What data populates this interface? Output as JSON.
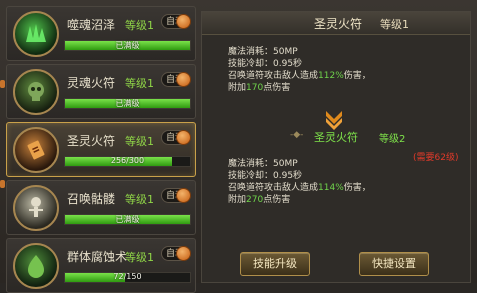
{
  "skills": [
    {
      "name": "噬魂沼泽",
      "level": "等级1",
      "auto": "自动",
      "bar_text": "已满级",
      "progress": 1.0,
      "icon": "swamp-icon"
    },
    {
      "name": "灵魂火符",
      "level": "等级1",
      "auto": "自动",
      "bar_text": "已满级",
      "progress": 1.0,
      "icon": "skull-icon"
    },
    {
      "name": "圣灵火符",
      "level": "等级1",
      "auto": "自动",
      "bar_text": "256/300",
      "progress": 0.853,
      "icon": "fire-talisman-icon"
    },
    {
      "name": "召唤骷髅",
      "level": "等级1",
      "auto": "自动",
      "bar_text": "已满级",
      "progress": 1.0,
      "icon": "skeleton-icon"
    },
    {
      "name": "群体腐蚀术",
      "level": "等级1",
      "auto": "自动",
      "bar_text": "72/150",
      "progress": 0.48,
      "icon": "corrosion-icon"
    }
  ],
  "detail": {
    "name": "圣灵火符",
    "level": "等级1",
    "current": {
      "mana": "魔法消耗：50MP",
      "cooldown": "技能冷却：0.95秒",
      "desc_pre": "召唤道符攻击敌人造成",
      "desc_pct": "112%",
      "desc_post": "伤害，",
      "add_pre": "附加",
      "add_val": "170",
      "add_post": "点伤害"
    },
    "next_name": "圣灵火符",
    "next_level": "等级2",
    "requirement": "(需要62级)",
    "next": {
      "mana": "魔法消耗：50MP",
      "cooldown": "技能冷却：0.95秒",
      "desc_pre": "召唤道符攻击敌人造成",
      "desc_pct": "114%",
      "desc_post": "伤害，",
      "add_pre": "附加",
      "add_val": "270",
      "add_post": "点伤害"
    },
    "upgrade_button": "技能升级",
    "shortcut_button": "快捷设置"
  }
}
